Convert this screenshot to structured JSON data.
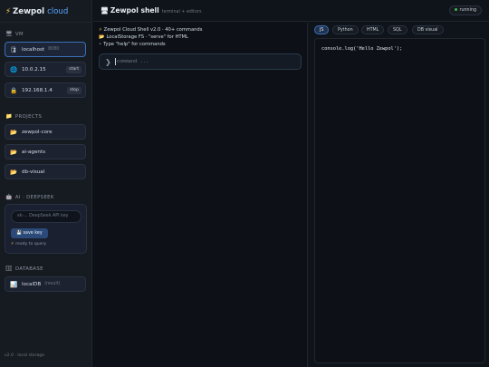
{
  "brand": {
    "name": "Zewpol",
    "accent": "cloud"
  },
  "sidebar": {
    "vm_title": "VM",
    "vms": [
      {
        "label": "localhost",
        "detail": "8080",
        "button": ""
      },
      {
        "label": "10.0.2.15",
        "detail": "",
        "button": "start"
      },
      {
        "label": "192.168.1.4",
        "detail": "",
        "button": "stop"
      }
    ],
    "projects_title": "PROJECTS",
    "projects": [
      {
        "label": "zewpol-core"
      },
      {
        "label": "ai-agents"
      },
      {
        "label": "db-visual"
      }
    ],
    "ai_title": "AI · DEEPSEEK",
    "ai": {
      "placeholder": "sk-... DeepSeek API key",
      "save_label": "save key",
      "status": "ready to query"
    },
    "database_title": "DATABASE",
    "database": {
      "label": "localDB",
      "tag": "(result)"
    },
    "footer": "v2.0 · local storage"
  },
  "header": {
    "title": "Zewpol shell",
    "subtitle": "terminal + editors",
    "status": "running"
  },
  "terminal": {
    "lines": [
      "Zewpol Cloud Shell v2.0 · 40+ commands",
      "LocalStorage FS · \"serve\" for HTML",
      "Type \"help\" for commands"
    ],
    "input_placeholder": "command ..."
  },
  "editor": {
    "tabs": [
      "JS",
      "Python",
      "HTML",
      "SQL",
      "DB visual"
    ],
    "active_tab": "JS",
    "code": "console.log('Hello Zewpol');"
  },
  "colors": {
    "accent": "#58a6ff",
    "active_border": "#3b6fb5",
    "running_dot": "#3fb950",
    "bolt": "#f5c542"
  }
}
